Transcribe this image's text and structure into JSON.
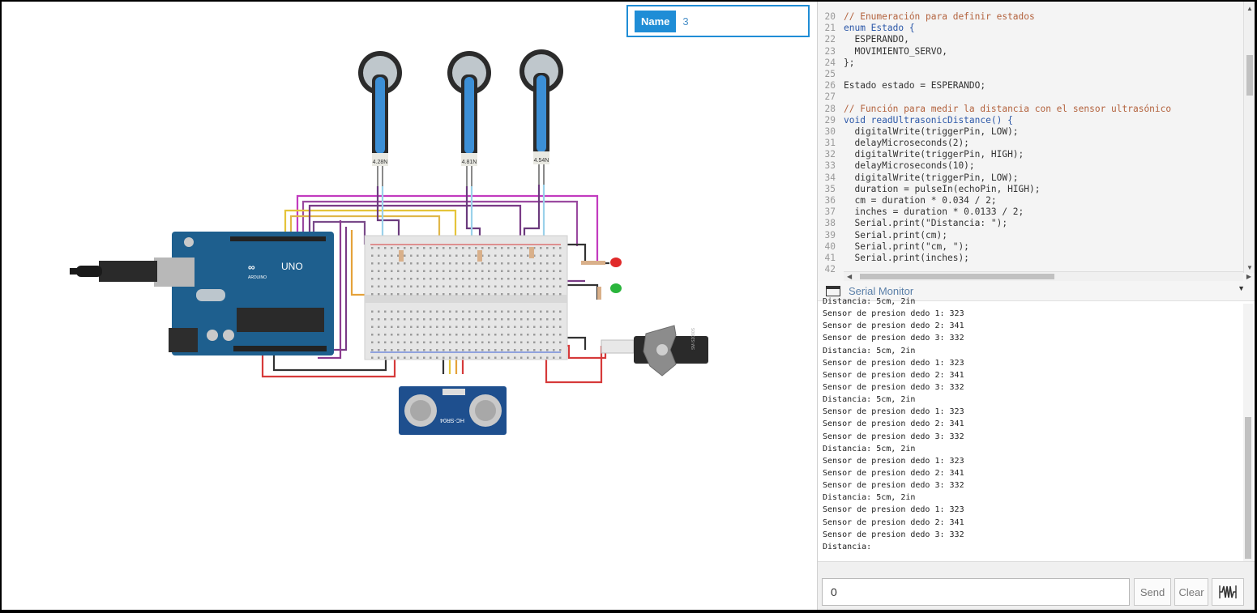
{
  "name_panel": {
    "label": "Name",
    "value": "3"
  },
  "components": {
    "force_sensors": [
      "4.28N",
      "4.81N",
      "4.54N"
    ],
    "board_logo": "UNO",
    "board_brand": "ARDUINO",
    "ultrasonic_label": "HC-SR04",
    "servo_label": "SM-S2090S"
  },
  "code": [
    {
      "n": "20",
      "t": "// Enumeración para definir estados",
      "c": "comment"
    },
    {
      "n": "21",
      "t": "enum Estado {",
      "c": "kw"
    },
    {
      "n": "22",
      "t": "  ESPERANDO,",
      "c": "plain"
    },
    {
      "n": "23",
      "t": "  MOVIMIENTO_SERVO,",
      "c": "plain"
    },
    {
      "n": "24",
      "t": "};",
      "c": "plain"
    },
    {
      "n": "25",
      "t": "",
      "c": "plain"
    },
    {
      "n": "26",
      "t": "Estado estado = ESPERANDO;",
      "c": "plain"
    },
    {
      "n": "27",
      "t": "",
      "c": "plain"
    },
    {
      "n": "28",
      "t": "// Función para medir la distancia con el sensor ultrasónico",
      "c": "comment"
    },
    {
      "n": "29",
      "t": "void readUltrasonicDistance() {",
      "c": "kw"
    },
    {
      "n": "30",
      "t": "  digitalWrite(triggerPin, LOW);",
      "c": "plain"
    },
    {
      "n": "31",
      "t": "  delayMicroseconds(2);",
      "c": "num"
    },
    {
      "n": "32",
      "t": "  digitalWrite(triggerPin, HIGH);",
      "c": "plain"
    },
    {
      "n": "33",
      "t": "  delayMicroseconds(10);",
      "c": "num"
    },
    {
      "n": "34",
      "t": "  digitalWrite(triggerPin, LOW);",
      "c": "plain"
    },
    {
      "n": "35",
      "t": "  duration = pulseIn(echoPin, HIGH);",
      "c": "plain"
    },
    {
      "n": "36",
      "t": "  cm = duration * 0.034 / 2;",
      "c": "num"
    },
    {
      "n": "37",
      "t": "  inches = duration * 0.0133 / 2;",
      "c": "num"
    },
    {
      "n": "38",
      "t": "  Serial.print(\"Distancia: \");",
      "c": "str"
    },
    {
      "n": "39",
      "t": "  Serial.print(cm);",
      "c": "plain"
    },
    {
      "n": "40",
      "t": "  Serial.print(\"cm, \");",
      "c": "str"
    },
    {
      "n": "41",
      "t": "  Serial.print(inches);",
      "c": "plain"
    },
    {
      "n": "42",
      "t": "",
      "c": "plain"
    }
  ],
  "serial_monitor": {
    "title": "Serial Monitor",
    "lines": [
      "Distancia: 5cm, 2in",
      "Sensor de presion dedo 1: 323",
      "Sensor de presion dedo 2: 341",
      "Sensor de presion dedo 3: 332",
      "Distancia: 5cm, 2in",
      "Sensor de presion dedo 1: 323",
      "Sensor de presion dedo 2: 341",
      "Sensor de presion dedo 3: 332",
      "Distancia: 5cm, 2in",
      "Sensor de presion dedo 1: 323",
      "Sensor de presion dedo 2: 341",
      "Sensor de presion dedo 3: 332",
      "Distancia: 5cm, 2in",
      "Sensor de presion dedo 1: 323",
      "Sensor de presion dedo 2: 341",
      "Sensor de presion dedo 3: 332",
      "Distancia: 5cm, 2in",
      "Sensor de presion dedo 1: 323",
      "Sensor de presion dedo 2: 341",
      "Sensor de presion dedo 3: 332",
      "Distancia:"
    ],
    "input_value": "0",
    "send_label": "Send",
    "clear_label": "Clear",
    "graph_icon": "graph-icon"
  },
  "colors": {
    "accent": "#1f8dd6",
    "comment": "#b3623d",
    "keyword": "#2b57a8",
    "number": "#2f8f4e",
    "string": "#c03b3b",
    "board": "#1e5f8e"
  }
}
